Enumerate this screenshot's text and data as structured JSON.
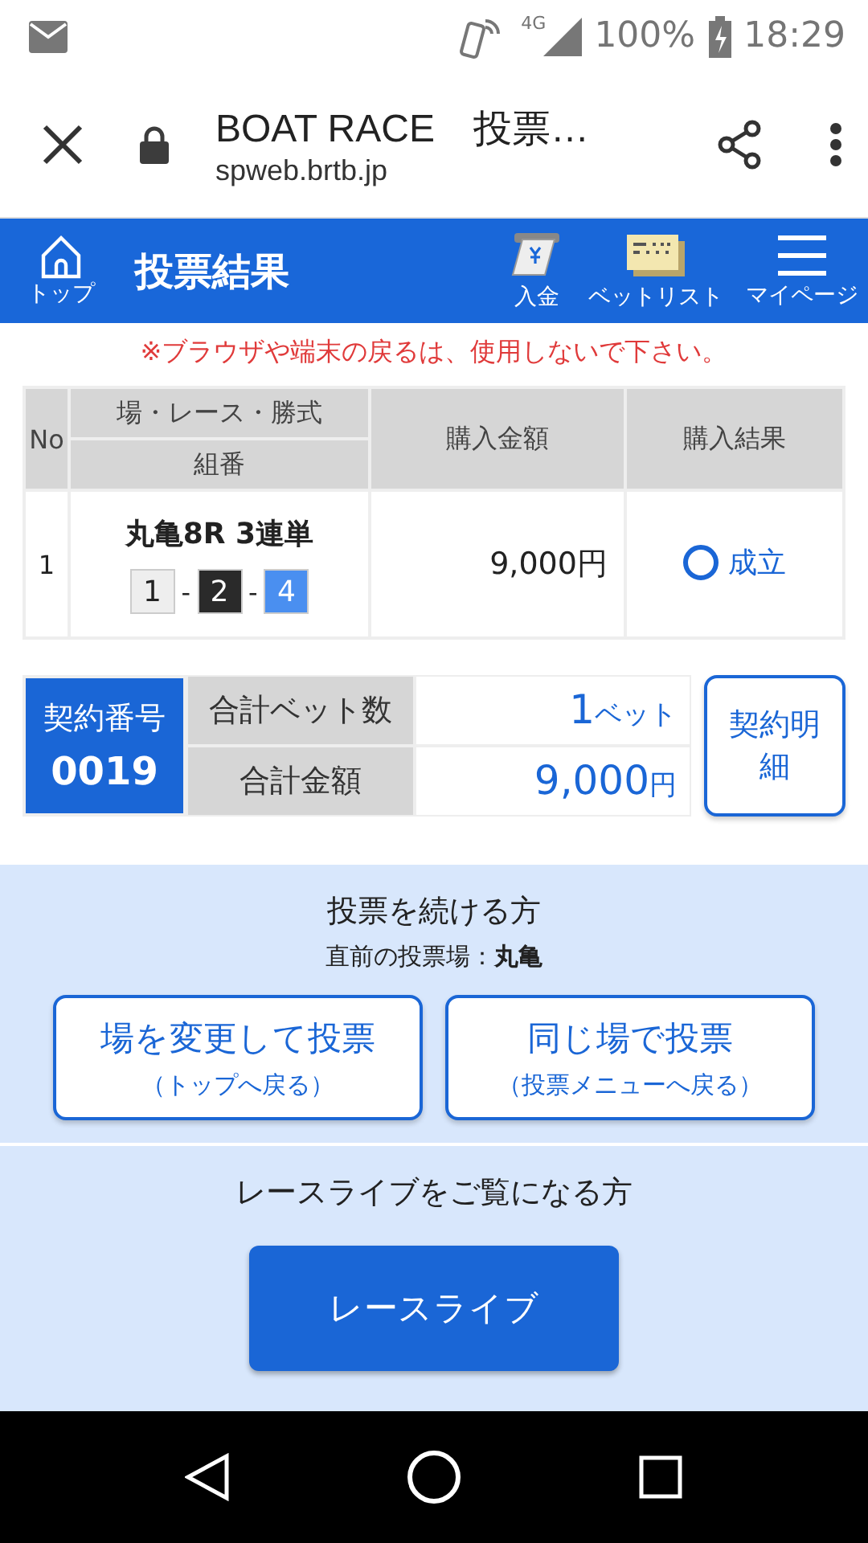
{
  "status_bar": {
    "battery": "100%",
    "time": "18:29",
    "network": "4G"
  },
  "browser": {
    "title": "BOAT RACE　投票…",
    "url": "spweb.brtb.jp"
  },
  "header": {
    "home_label": "トップ",
    "title": "投票結果",
    "actions": [
      {
        "kind": "deposit",
        "label": "入金"
      },
      {
        "kind": "betlist",
        "label": "ベットリスト"
      },
      {
        "kind": "menu",
        "label": "マイページ"
      }
    ]
  },
  "notice": "※ブラウザや端末の戻るは、使用しないで下さい。",
  "table": {
    "columns": [
      "No",
      "場・レース・勝式",
      "組番",
      "購入金額",
      "購入結果"
    ],
    "rows": [
      {
        "no": "1",
        "race": "丸亀8R 3連単",
        "combination": [
          {
            "number": "1",
            "color": "#eeeeee"
          },
          {
            "number": "2",
            "color": "#2a2a2a"
          },
          {
            "number": "4",
            "color": "#4a8ff0"
          }
        ],
        "separator": "-",
        "amount": "9,000円",
        "result": "成立"
      }
    ]
  },
  "contract": {
    "label": "契約番号",
    "number": "0019",
    "rows": [
      {
        "label": "合計ベット数",
        "value": "1",
        "unit": "ベット"
      },
      {
        "label": "合計金額",
        "value": "9,000",
        "unit": "円"
      }
    ],
    "detail_button": "契約明細"
  },
  "continue": {
    "title": "投票を続ける方",
    "last_venue": "直前の投票場：**丸亀**",
    "buttons": [
      {
        "label": "場を変更して投票",
        "sub": "（トップへ戻る）"
      },
      {
        "label": "同じ場で投票",
        "sub": "（投票メニューへ戻る）"
      }
    ]
  },
  "live": {
    "title": "レースライブをご覧になる方",
    "button": "レースライブ"
  }
}
